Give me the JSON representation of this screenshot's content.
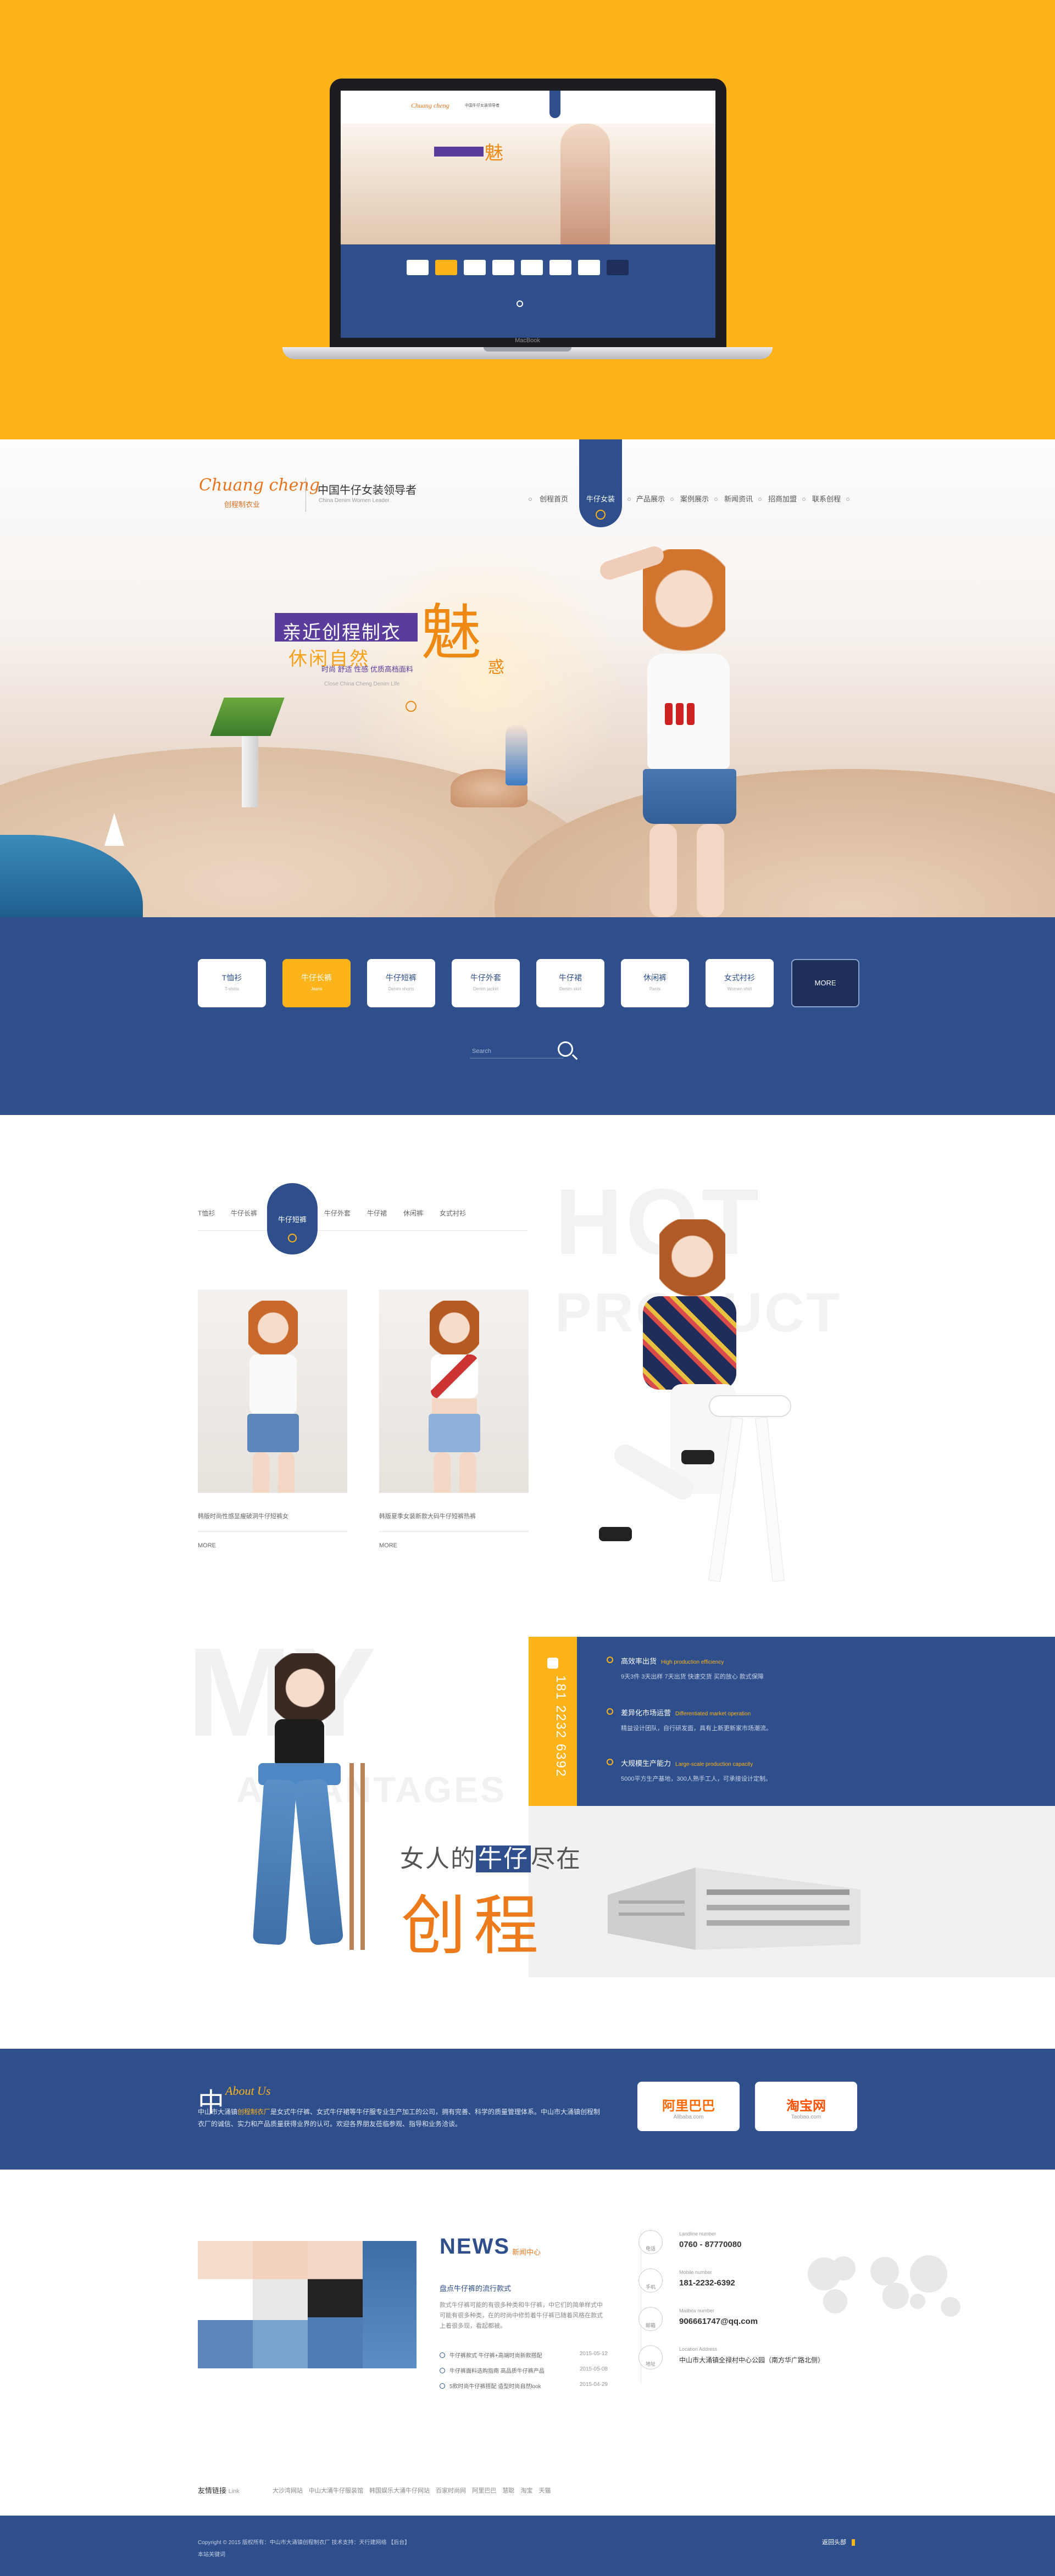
{
  "mockup": {
    "laptop_brand": "MacBook"
  },
  "header": {
    "logo_script": "Chuang cheng",
    "logo_sub": "创程制衣业",
    "tagline": "中国牛仔女装领导者",
    "tagline_en": "China Denim Women Leader",
    "nav": [
      "创程首页",
      "牛仔女装",
      "产品展示",
      "案例展示",
      "新闻资讯",
      "招商加盟",
      "联系创程"
    ],
    "nav_active": "牛仔女装"
  },
  "hero": {
    "line1": "亲近创程制衣",
    "line2": "休闲自然",
    "line3": "时尚 舒适 性感 优质高档面料",
    "mei": "魅",
    "huo": "惑",
    "en": "Close China Cheng Denim Life"
  },
  "categories": [
    {
      "label": "T恤衫",
      "en": "T-shirts"
    },
    {
      "label": "牛仔长裤",
      "en": "Jeans"
    },
    {
      "label": "牛仔短裤",
      "en": "Denim shorts"
    },
    {
      "label": "牛仔外套",
      "en": "Denim jacket"
    },
    {
      "label": "牛仔裙",
      "en": "Denim skirt"
    },
    {
      "label": "休闲裤",
      "en": "Pants"
    },
    {
      "label": "女式衬衫",
      "en": "Women shirt"
    }
  ],
  "categories_active": 1,
  "more_label": "MORE",
  "search": {
    "placeholder": "Search"
  },
  "hot": {
    "bg_word1": "HOT",
    "bg_word2": "PRODUCT",
    "tabs": [
      "T恤衫",
      "牛仔长裤",
      "牛仔短裤",
      "牛仔外套",
      "牛仔裙",
      "休闲裤",
      "女式衬衫"
    ],
    "tab_active": "牛仔短裤",
    "cards": [
      {
        "caption": "韩版时尚性感显瘦破洞牛仔短裤女",
        "more": "MORE"
      },
      {
        "caption": "韩版夏季女装新款大码牛仔短裤热裤",
        "more": "MORE"
      }
    ]
  },
  "advantages": {
    "bg_word1": "MY",
    "bg_word2": "ADVANTAGES",
    "phone": "181 2232 6392",
    "items": [
      {
        "title": "高效率出货",
        "en": "High production efficiency",
        "desc": "9天3件 3天出样 7天出货 快速交货 买的放心 款式保障"
      },
      {
        "title": "差异化市场运营",
        "en": "Differentiated market operation",
        "desc": "精益设计团队，自行研发面，具有上新更新家市场潮流。"
      },
      {
        "title": "大规模生产能力",
        "en": "Large-scale production capacity",
        "desc": "5000平方生产基地，300人熟手工人，可承接设计定制。"
      }
    ],
    "slogan_pre": "女人的",
    "slogan_hl": "牛仔",
    "slogan_post": "尽在",
    "cheng": "创程"
  },
  "about": {
    "zh": "中",
    "en": "About Us",
    "text_pre": "中山市大涌镇",
    "text_hl": "创程制衣厂",
    "text_post": "是女式牛仔裤、女式牛仔裙等牛仔服专业生产加工的公司，拥有完善、科学的质量管理体系。中山市大涌镇创程制衣厂的诚信、实力和产品质量获得业界的认可。欢迎各界朋友莅临参观、指导和业务洽谈。"
  },
  "partners": [
    {
      "name": "阿里巴巴",
      "url": "Alibaba.com",
      "color": "#ff6a00"
    },
    {
      "name": "淘宝网",
      "url": "Taobao.com",
      "color": "#ff5000"
    }
  ],
  "news": {
    "title_main": "NEWS",
    "title_sub": "新闻中心",
    "headline": "盘点牛仔裤的流行款式",
    "desc": "款式牛仔裤可能的有很多种类和牛仔裤，中它们的简单样式中可能有很多种类，在的时尚中修剪着牛仔裤已随着风格在款式上着很多现，看起都被。",
    "rows": [
      {
        "t": "牛仔裤款式 牛仔裤+高端时尚新款搭配",
        "d": "2015-05-12"
      },
      {
        "t": "牛仔裤面料选购指南 高品质牛仔裤产品",
        "d": "2015-05-08"
      },
      {
        "t": "5款时尚牛仔裤搭配 造型时尚自然look",
        "d": "2015-04-29"
      }
    ]
  },
  "contact": [
    {
      "icon": "电话",
      "label": "Landline number",
      "value": "0760 - 87770080"
    },
    {
      "icon": "手机",
      "label": "Mobile number",
      "value": "181-2232-6392"
    },
    {
      "icon": "邮箱",
      "label": "Mailbox number",
      "value": "906661747@qq.com"
    },
    {
      "icon": "地址",
      "label": "Location Address",
      "value": "中山市大涌镇全禄村中心公园（南方华广路北侧）"
    }
  ],
  "friends": {
    "label": "友情链接",
    "en": "Link",
    "links": [
      "大沙湾网站",
      "中山大涌牛仔服装馆",
      "韩国娱乐大涌牛仔网站",
      "百家时尚网",
      "阿里巴巴",
      "慧聪",
      "淘宝",
      "天猫"
    ]
  },
  "footer": {
    "line1": "Copyright © 2015 版权所有：中山市大涌镇创程制衣厂 技术支持：天行建网络 【后台】",
    "line2": "本站关键词",
    "back_top": "返回头部"
  },
  "colors": {
    "primary": "#2e4f8c",
    "accent": "#fdb31a",
    "orange": "#ee7b1b"
  }
}
